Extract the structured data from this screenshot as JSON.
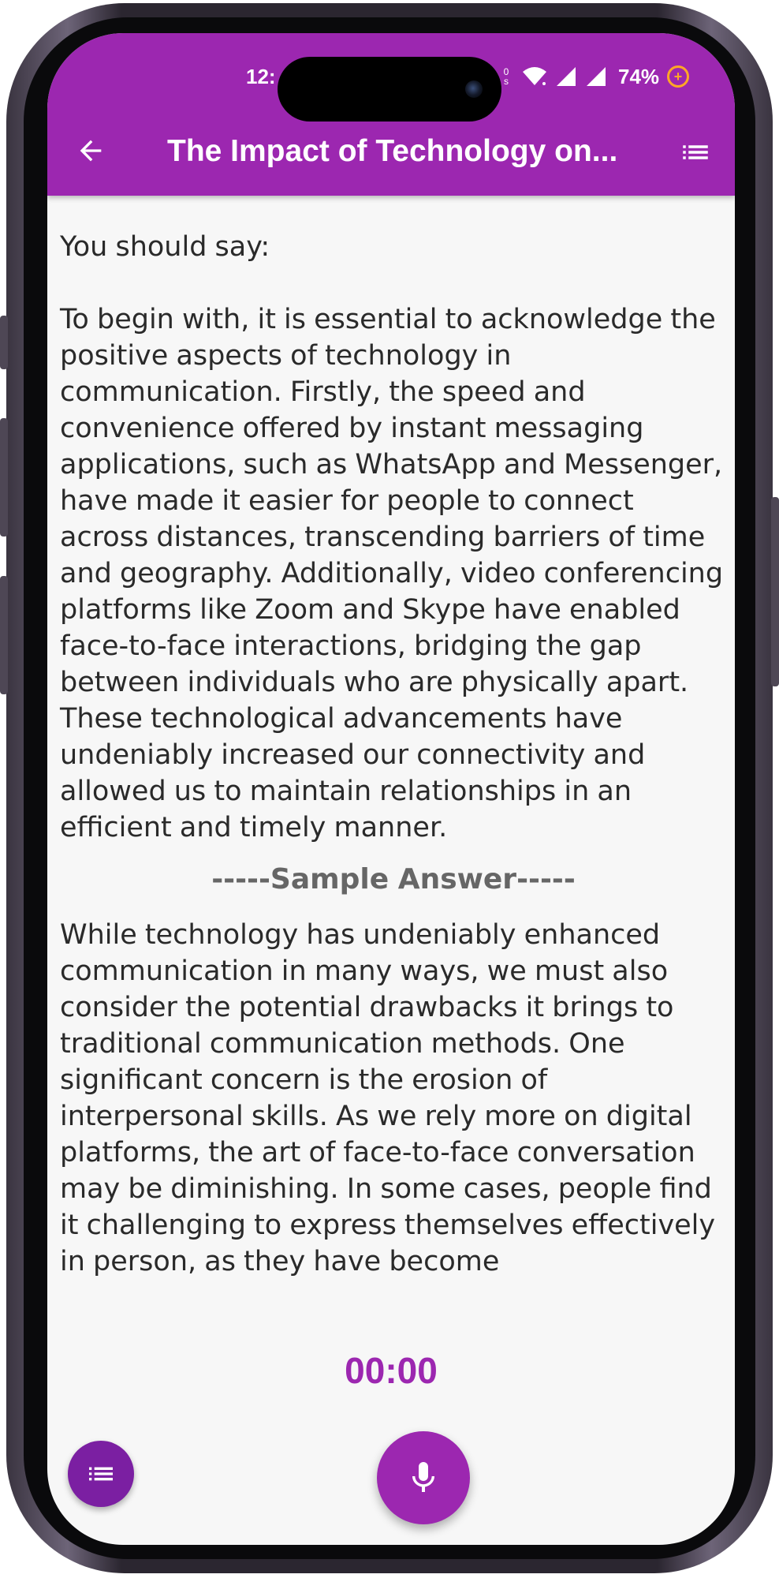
{
  "status_bar": {
    "time": "12:",
    "net_speed_top": "0",
    "net_speed_bottom": "s",
    "battery": "74%"
  },
  "app_bar": {
    "title": "The Impact of Technology on..."
  },
  "content": {
    "prompt": "You should say:",
    "paragraph_1": "To begin with, it is essential to acknowledge the positive aspects of technology in communication. Firstly, the speed and convenience offered by instant messaging applications, such as WhatsApp and Messenger, have made it easier for people to connect across distances, transcending barriers of time and geography. Additionally, video conferencing platforms like Zoom and Skype have enabled face-to-face interactions, bridging the gap between individuals who are physically apart. These technological advancements have undeniably increased our connectivity and allowed us to maintain relationships in an efficient and timely manner.",
    "sample_heading": "-----Sample Answer-----",
    "paragraph_2": "While technology has undeniably enhanced communication in many ways, we must also consider the potential drawbacks it brings to traditional communication methods. One significant concern is the erosion of interpersonal skills. As we rely more on digital platforms, the art of face-to-face conversation may be diminishing. In some cases, people find it challenging to express themselves effectively in person, as they have become"
  },
  "timer": "00:00",
  "colors": {
    "primary": "#9c27b0",
    "primary_dark": "#7b1fa2",
    "background": "#f7f7f7",
    "text": "#2a2a2a"
  },
  "icons": {
    "back": "arrow-back-icon",
    "list": "list-icon",
    "mic": "mic-icon"
  }
}
